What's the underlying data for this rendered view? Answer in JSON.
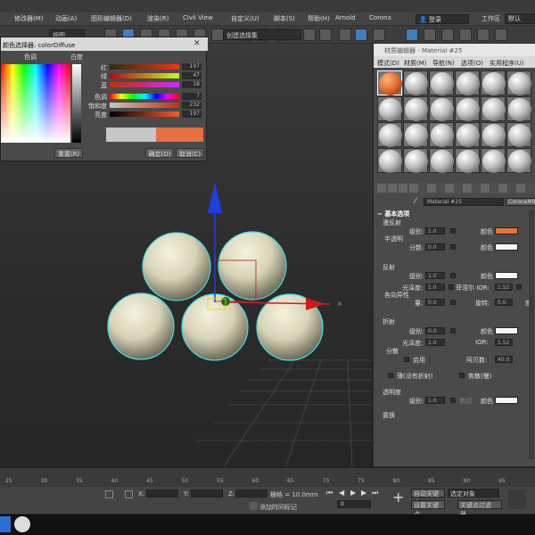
{
  "menubar": {
    "items": [
      "修改器(M)",
      "动画(A)",
      "图形编辑器(D)",
      "渲染(R)",
      "Civil View",
      "自定义(U)",
      "脚本(S)",
      "帮助(H)",
      "Arnold",
      "Corona"
    ],
    "login": "登录",
    "workspace": "工作区",
    "default": "默认"
  },
  "toolbar": {
    "view_dropdown": "视图",
    "selection_set": "创建选择集"
  },
  "color_dialog": {
    "title": "颜色选择器: colorDiffuse",
    "hue_header": "色调",
    "whiteness_header": "白度",
    "sliders": [
      {
        "label": "红",
        "value": "197"
      },
      {
        "label": "绿",
        "value": "47"
      },
      {
        "label": "蓝",
        "value": "18"
      },
      {
        "label": "色调",
        "value": "7"
      },
      {
        "label": "饱和度",
        "value": "232"
      },
      {
        "label": "亮度",
        "value": "197"
      }
    ],
    "reset_button": "重置(R)",
    "ok_button": "确定(O)",
    "cancel_button": "取消(C)",
    "old_color": "#c7c7c7",
    "new_color": "#e6703f"
  },
  "material_editor": {
    "title": "材质编辑器 - Material #25",
    "menu": [
      "模式(D)",
      "材质(M)",
      "导航(N)",
      "选项(O)",
      "实用程序(U)"
    ],
    "material_name": "Material #25",
    "material_type": "CoronaMtl",
    "rollout_title": "基本选项",
    "diffuse": {
      "header": "漫反射",
      "level_label": "级别:",
      "level_value": "1.0",
      "color_label": "颜色",
      "translucency_label": "半透明",
      "fraction_label": "分数:",
      "fraction_value": "0.0",
      "color": "#e6703f"
    },
    "reflection": {
      "header": "反射",
      "level_label": "级别:",
      "level_value": "1.0",
      "color_label": "颜色",
      "gloss_label": "光泽度:",
      "gloss_value": "1.0",
      "fresnel_label": "菲涅尔 IOR:",
      "fresnel_value": "1.52",
      "aniso_label": "各向异性",
      "amount_label": "量:",
      "amount_value": "0.0",
      "rotation_label": "旋转:",
      "rotation_value": "0.0",
      "degree_label": "度"
    },
    "refraction": {
      "header": "折射",
      "level_label": "级别:",
      "level_value": "0.0",
      "color_label": "颜色",
      "gloss_label": "光泽度:",
      "gloss_value": "1.0",
      "ior_label": "IOR:",
      "ior_value": "1.52",
      "dispersion_label": "分散",
      "enable_label": "启用",
      "abbe_label": "阿贝数:",
      "abbe_value": "40.0",
      "thin_label": "薄(没有折射)",
      "caustics_label": "焦散(慢)"
    },
    "opacity": {
      "header": "透明度",
      "level_label": "级别:",
      "level_value": "1.0",
      "clip_label": "剪切",
      "color_label": "颜色"
    },
    "displacement": {
      "header": "置换"
    }
  },
  "timeline": {
    "ticks": [
      "25",
      "30",
      "35",
      "40",
      "45",
      "50",
      "55",
      "60",
      "65",
      "70",
      "75",
      "80",
      "85",
      "90",
      "95"
    ]
  },
  "status": {
    "x_label": "X:",
    "y_label": "Y:",
    "z_label": "Z:",
    "grid": "栅格 = 10.0mm",
    "add_time_tag": "添加时间标记",
    "auto_key": "自动关键点",
    "set_key": "设置关键点",
    "selected_obj": "选定对象",
    "key_filter": "关键点过滤器...",
    "frame": "0"
  }
}
